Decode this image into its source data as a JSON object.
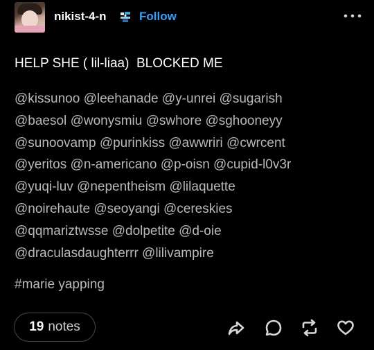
{
  "header": {
    "username": "nikist-4-n",
    "follow_label": "Follow",
    "avatar_icon": "avatar-photo",
    "badge_icon": "collectible-badge-icon",
    "more_icon": "more-dots-icon"
  },
  "post": {
    "title": "HELP SHE ( lil-liaa)  BLOCKED ME",
    "mention_lines": [
      [
        "@kissunoo",
        "@leehanade",
        "@y-unrei",
        "@sugarish"
      ],
      [
        "@baesol",
        "@wonysmiu",
        "@swhore",
        "@sghooneyy"
      ],
      [
        "@sunoovamp",
        "@purinkiss",
        "@awwriri",
        "@cwrcent"
      ],
      [
        "@yeritos",
        "@n-americano",
        "@p-oisn",
        "@cupid-l0v3r"
      ],
      [
        "@yuqi-luv",
        "@nepentheism",
        "@lilaquette"
      ],
      [
        "@noirehaute",
        "@seoyangi",
        "@cereskies"
      ],
      [
        "@qqmariztwsse",
        "@dolpetite",
        "@d-oie"
      ],
      [
        "@draculasdaughterrr",
        "@lilivampire"
      ]
    ],
    "tag": "#marie yapping"
  },
  "footer": {
    "notes_count": "19",
    "notes_label": "notes",
    "actions": [
      "share-icon",
      "reply-icon",
      "reblog-icon",
      "like-icon"
    ]
  },
  "colors": {
    "background": "#000000",
    "text": "#ffffff",
    "muted_text": "#b9b9b9",
    "follow": "#3a9ff5",
    "notes_border": "#4a4a4a"
  }
}
